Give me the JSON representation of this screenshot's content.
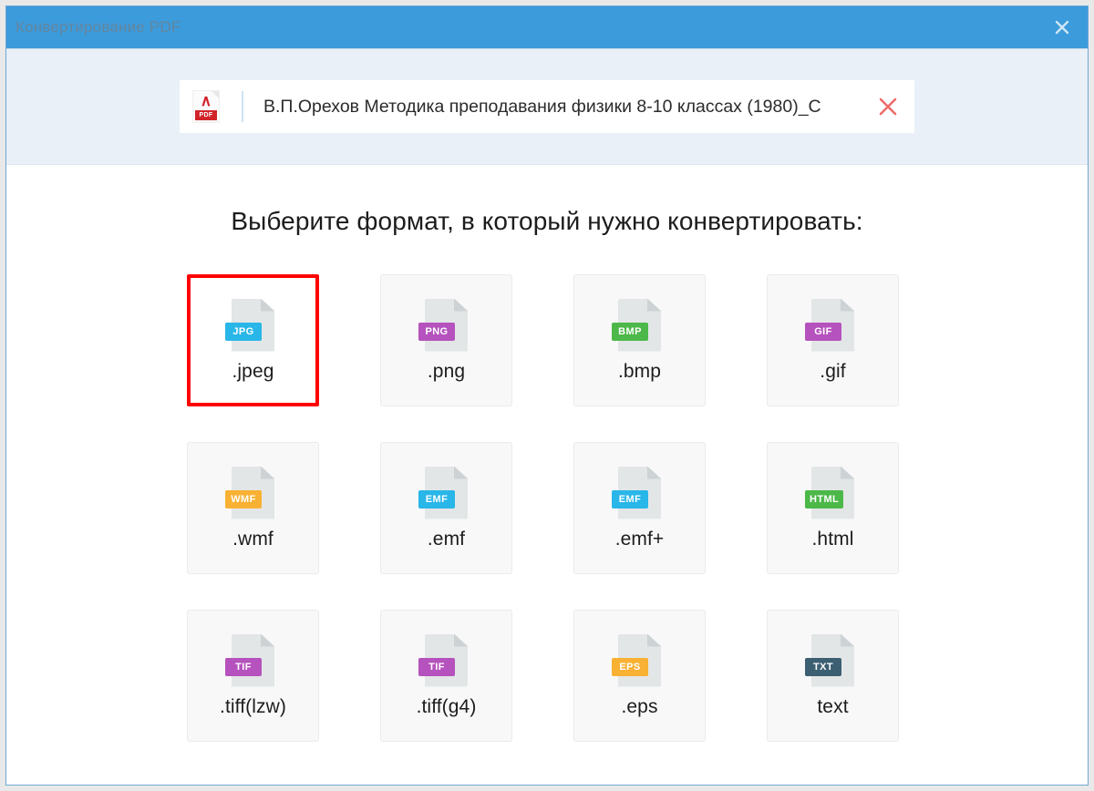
{
  "window": {
    "title": "Конвертирование PDF",
    "close_icon": "close-icon"
  },
  "file_strip": {
    "file_icon": "pdf-file-icon",
    "pdf_badge_label": "PDF",
    "file_name": "В.П.Орехов Методика преподавания физики 8-10 классах (1980)_С",
    "remove_icon": "close-icon"
  },
  "content": {
    "heading": "Выберите формат, в который нужно конвертировать:"
  },
  "formats": [
    {
      "label": ".jpeg",
      "badge": "JPG",
      "badge_color": "#29b6e8",
      "selected": true
    },
    {
      "label": ".png",
      "badge": "PNG",
      "badge_color": "#b552bd",
      "selected": false
    },
    {
      "label": ".bmp",
      "badge": "BMP",
      "badge_color": "#4cb849",
      "selected": false
    },
    {
      "label": ".gif",
      "badge": "GIF",
      "badge_color": "#b552bd",
      "selected": false
    },
    {
      "label": ".wmf",
      "badge": "WMF",
      "badge_color": "#f8b133",
      "selected": false
    },
    {
      "label": ".emf",
      "badge": "EMF",
      "badge_color": "#29b6e8",
      "selected": false
    },
    {
      "label": ".emf+",
      "badge": "EMF",
      "badge_color": "#29b6e8",
      "selected": false
    },
    {
      "label": ".html",
      "badge": "HTML",
      "badge_color": "#4cb849",
      "selected": false
    },
    {
      "label": ".tiff(lzw)",
      "badge": "TIF",
      "badge_color": "#b552bd",
      "selected": false
    },
    {
      "label": ".tiff(g4)",
      "badge": "TIF",
      "badge_color": "#b552bd",
      "selected": false
    },
    {
      "label": ".eps",
      "badge": "EPS",
      "badge_color": "#f8b133",
      "selected": false
    },
    {
      "label": "text",
      "badge": "TXT",
      "badge_color": "#3c5f72",
      "selected": false
    }
  ],
  "theme": {
    "titlebar_color": "#3c9bdb",
    "strip_color": "#e9f0f8",
    "selection_color": "#ff0000",
    "remove_icon_color": "#ef6b6b"
  }
}
